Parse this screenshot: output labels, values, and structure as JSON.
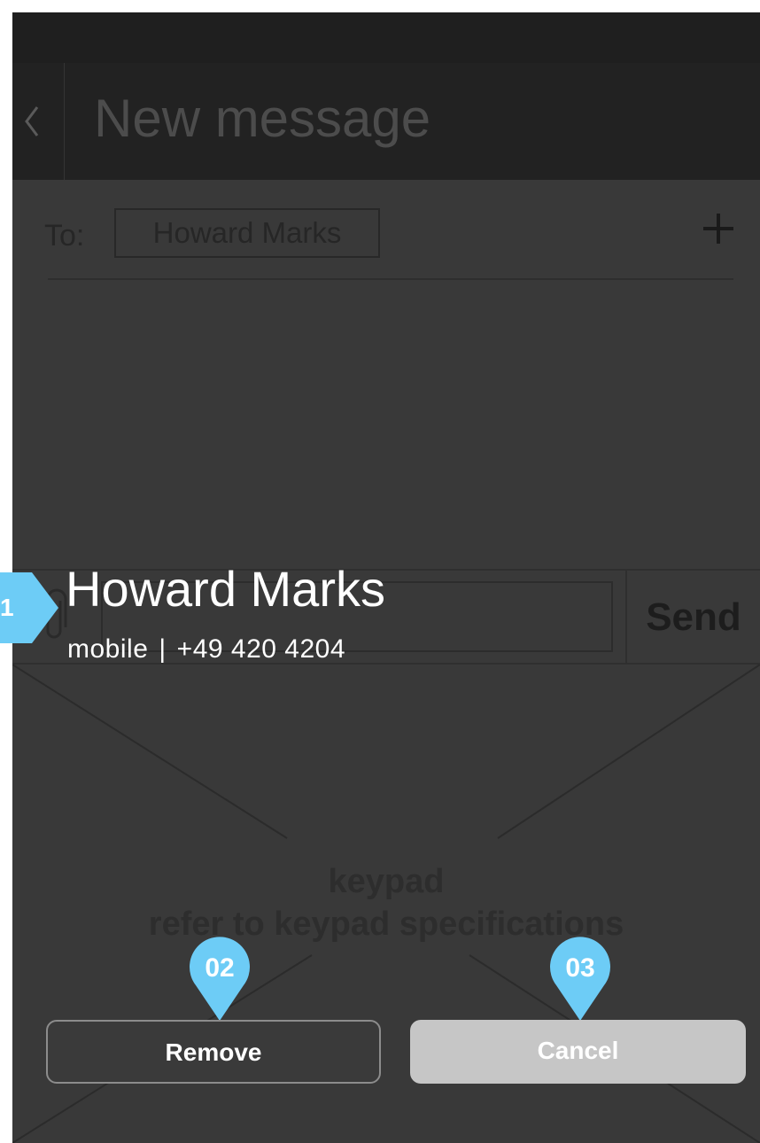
{
  "header": {
    "title": "New message"
  },
  "recipient": {
    "to_label": "To:",
    "name": "Howard Marks"
  },
  "compose": {
    "send_label": "Send"
  },
  "keypad": {
    "title": "keypad",
    "subtitle": "refer to keypad specifications"
  },
  "contact_popup": {
    "name": "Howard Marks",
    "phone_type": "mobile",
    "separator": "|",
    "phone_number": "+49 420 4204"
  },
  "annotations": {
    "marker_1": "1",
    "marker_2": "02",
    "marker_3": "03",
    "accent_color": "#6dccf6"
  },
  "actions": {
    "remove_label": "Remove",
    "cancel_label": "Cancel"
  },
  "icons": [
    "back-chevron-icon",
    "plus-icon",
    "paperclip-icon"
  ]
}
